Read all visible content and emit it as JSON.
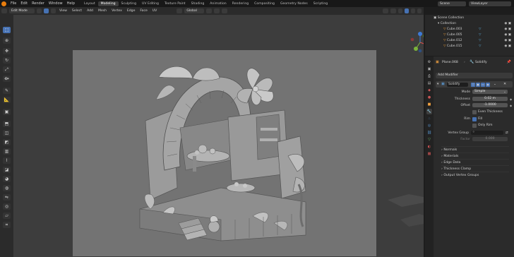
{
  "menubar": {
    "items": [
      "File",
      "Edit",
      "Render",
      "Window",
      "Help"
    ],
    "workspaces": [
      "Layout",
      "Modeling",
      "Sculpting",
      "UV Editing",
      "Texture Paint",
      "Shading",
      "Animation",
      "Rendering",
      "Compositing",
      "Geometry Nodes",
      "Scripting"
    ],
    "active_workspace": "Modeling",
    "scene": "Scene",
    "view_layer": "ViewLayer"
  },
  "header": {
    "mode": "Edit Mode",
    "menus": [
      "View",
      "Select",
      "Add",
      "Mesh",
      "Vertex",
      "Edge",
      "Face",
      "UV"
    ],
    "transform_orientation": "Global",
    "options": "Options"
  },
  "outliner": {
    "root": "Scene Collection",
    "collection": "Collection",
    "objects": [
      "Cube.003",
      "Cube.005",
      "Cube.012",
      "Cube.015"
    ]
  },
  "properties": {
    "object": "Plane.068",
    "modifier_crumb": "Solidify",
    "add_modifier": "Add Modifier",
    "modifier_name": "Solidify",
    "fields": {
      "mode_label": "Mode",
      "mode_value": "Simple",
      "thickness_label": "Thickness",
      "thickness_value": "0.02 m",
      "offset_label": "Offset",
      "offset_value": "-1.0000",
      "even_thickness": "Even Thickness",
      "rim_label": "Rim",
      "fill": "Fill",
      "only_rim": "Only Rim",
      "vertex_group_label": "Vertex Group",
      "factor_label": "Factor",
      "factor_value": "0.000"
    },
    "subpanels": [
      "Normals",
      "Materials",
      "Edge Data",
      "Thickness Clamp",
      "Output Vertex Groups"
    ]
  },
  "colors": {
    "accent": "#4772b3",
    "orange": "#e87d0d",
    "viewport_bg": "#3d3d3d",
    "camera_bg": "#737373"
  }
}
